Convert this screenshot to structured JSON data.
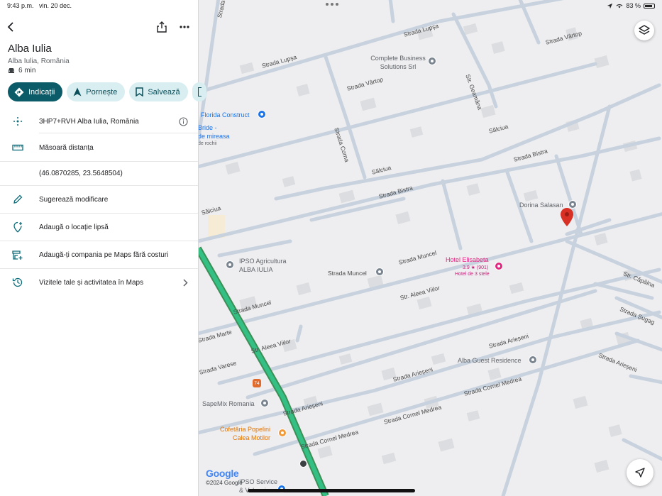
{
  "status": {
    "time": "9:43 p.m.",
    "date": "vin. 20 dec.",
    "battery": "83 %"
  },
  "place": {
    "title": "Alba Iulia",
    "subtitle": "Alba Iulia, România",
    "eta": "6 min"
  },
  "actions": [
    {
      "label": "Indicații"
    },
    {
      "label": "Pornește"
    },
    {
      "label": "Salvează"
    }
  ],
  "rows": [
    {
      "label": "3HP7+RVH Alba Iulia, România"
    },
    {
      "label": "Măsoară distanța"
    },
    {
      "label": "(46.0870285, 23.5648504)"
    },
    {
      "label": "Sugerează modificare"
    },
    {
      "label": "Adaugă o locație lipsă"
    },
    {
      "label": "Adaugă-ți compania pe Maps fără costuri"
    },
    {
      "label": "Vizitele tale și activitatea în Maps"
    }
  ],
  "map": {
    "pois": {
      "complete_business": "Complete Business Solutions Srl",
      "florida": "Florida Construct",
      "bride": "Bride -",
      "bride2": "de mireasa",
      "bride3": "de rochii",
      "dorina": "Dorina Salasan",
      "ipso": "IPSO Agricultura",
      "ipso2": "ALBA IULIA",
      "hotel": "Hotel Elisabeta",
      "hotel_rating": "3.9 ★ (901)",
      "hotel_class": "Hotel de 3 stele",
      "alba_guest": "Alba Guest Residence",
      "sapemix": "SapeMix Romania",
      "cofetaria": "Cofetăria Popelini",
      "cofetaria2": "Calea Motilor",
      "ipso_service": "IPSO Service",
      "ipso_service2": "& Vulcanizare"
    },
    "streets": {
      "lupsa1": "Strada Lupșa",
      "lupsa2": "Strada Lupșa",
      "vartop1": "Strada Vârtop",
      "vartop2": "Strada Vârtop",
      "geamana": "Str. Geamăna",
      "corna": "Strada Corna",
      "salciua1": "Sălciua",
      "salciua2": "Sălciua",
      "salciua3": "Sălciua",
      "bistra1": "Strada Bistra",
      "bistra2": "Strada Bistra",
      "muncel1": "Strada Muncel",
      "muncel2": "Strada Muncel",
      "muncel3": "Strada Muncel",
      "aleea1": "Str. Aleea Viilor",
      "aleea2": "Str. Aleea Viilor",
      "capalna": "Str. Căpâlna",
      "sugag": "Strada Șugag",
      "arieseni1": "Strada Arieșeni",
      "arieseni2": "Strada Arieșeni",
      "arieseni3": "Strada Arieșeni",
      "arieseni4": "Strada Arieșeni",
      "marte": "Strada Marte",
      "varese": "Strada Varese",
      "cornel1": "Strada Cornel Medrea",
      "cornel2": "Strada Cornel Medrea",
      "cornel3": "Strada Cornel Medrea",
      "bucium": "Strada Bucium",
      "route": "74"
    },
    "google": "Google",
    "copyright": "©2024 Google"
  }
}
